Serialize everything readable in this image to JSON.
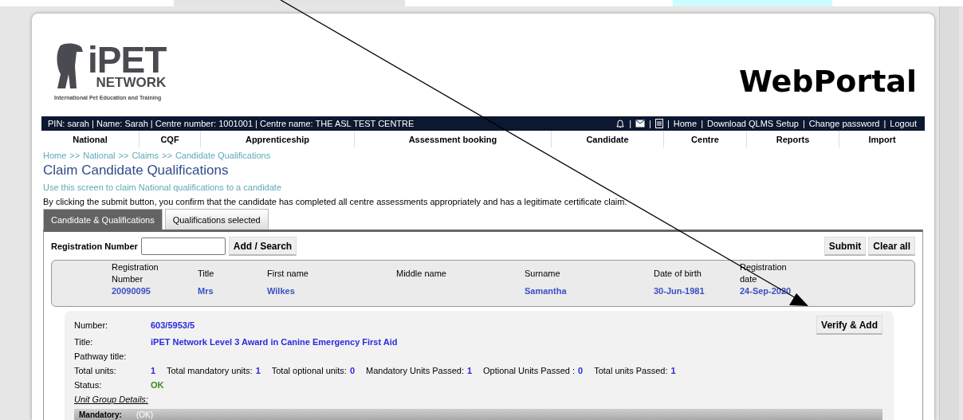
{
  "header": {
    "logo": {
      "brand": "iPET",
      "network": "NETWORK",
      "tagline": "International Pet Education and Training"
    },
    "portal_title": "WebPortal"
  },
  "user_bar": {
    "info": "PIN: sarah | Name: Sarah | Centre number: 1001001 | Centre name: THE ASL TEST CENTRE",
    "separator": "|",
    "links": [
      "Home",
      "Download QLMS Setup",
      "Change password",
      "Logout"
    ]
  },
  "nav": [
    "National",
    "CQF",
    "Apprenticeship",
    "Assessment booking",
    "Candidate",
    "Centre",
    "Reports",
    "Import"
  ],
  "breadcrumb": {
    "separator": ">>",
    "items": [
      "Home",
      "National",
      "Claims",
      "Candidate Qualifications"
    ]
  },
  "page_title": "Claim Candidate Qualifications",
  "subtitle": "Use this screen to claim National qualifications to a candidate",
  "notice": "By clicking the submit button, you confirm that the candidate has completed all centre assessments appropriately and has a legitimate certificate claim.",
  "tabs": [
    {
      "label": "Candidate & Qualifications",
      "selected": true
    },
    {
      "label": "Qualifications selected",
      "selected": false
    }
  ],
  "search": {
    "label": "Registration Number",
    "button": "Add / Search"
  },
  "actions": [
    "Submit",
    "Clear all"
  ],
  "candidate": {
    "columns": [
      {
        "header": "Registration Number",
        "value": "20090095"
      },
      {
        "header": "Title",
        "value": "Mrs"
      },
      {
        "header": "First name",
        "value": "Wilkes"
      },
      {
        "header": "Middle name"
      },
      {
        "header": "Surname",
        "value": "Samantha"
      },
      {
        "header": "Date of birth",
        "value": "30-Jun-1981"
      },
      {
        "header": "Registration date",
        "value": "24-Sep-2020"
      }
    ]
  },
  "qualification": {
    "number_label": "Number:",
    "number": "603/5953/5",
    "title_label": "Title:",
    "title": "iPET Network Level 3 Award in Canine Emergency First Aid",
    "pathway_label": "Pathway title:",
    "totals": [
      {
        "label": "Total units:",
        "value": "1"
      },
      {
        "label": "Total mandatory units:",
        "value": "1"
      },
      {
        "label": "Total optional units:",
        "value": "0"
      },
      {
        "label": "Mandatory Units Passed:",
        "value": "1"
      },
      {
        "label": "Optional Units Passed :",
        "value": "0"
      },
      {
        "label": "Total units Passed:",
        "value": "1"
      }
    ],
    "status_label": "Status:",
    "status": "OK",
    "unit_group_label": "Unit Group Details:",
    "verify_button": "Verify & Add",
    "group": {
      "title": "Mandatory:",
      "status": "(OK)"
    }
  }
}
